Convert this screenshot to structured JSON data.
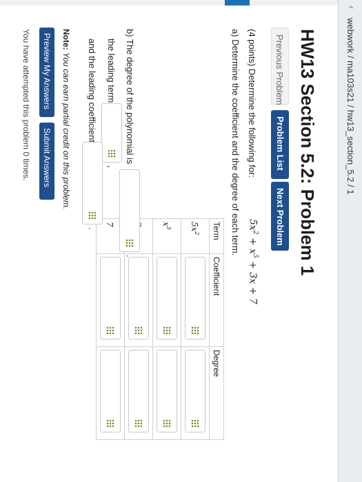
{
  "header": {
    "breadcrumb": "webwork / ma103s21 / hw13_section_5.2 / 1"
  },
  "page": {
    "title": "HW13 Section 5.2: Problem 1"
  },
  "nav": {
    "previous": "Previous Problem",
    "list": "Problem List",
    "next": "Next Problem"
  },
  "problem": {
    "intro": "(4 points) Determine the following for:",
    "expression": {
      "t1": "5x",
      "t1_exp": "2",
      "t2": "+ x",
      "t2_exp": "5",
      "t3": "+ 3x + 7"
    },
    "part_a": "a) Determine the coefficient and the degree of each term.",
    "table": {
      "headers": [
        "Term",
        "Coefficient",
        "Degree"
      ],
      "terms": [
        {
          "base": "5x",
          "exp": "2"
        },
        {
          "base": "x",
          "exp": "5"
        },
        {
          "base": "3x",
          "exp": ""
        },
        {
          "base": "7",
          "exp": ""
        }
      ]
    },
    "part_b": "b) The degree of the polynomial is",
    "lead_term": "the leading term is",
    "lead_coef": "and the leading coefficient is",
    "period": ".",
    "comma": ","
  },
  "footer": {
    "note_label": "Note:",
    "note_text": "You can earn partial credit on this problem.",
    "preview": "Preview My Answers",
    "submit": "Submit Answers",
    "attempts": "You have attempted this problem 0 times."
  }
}
